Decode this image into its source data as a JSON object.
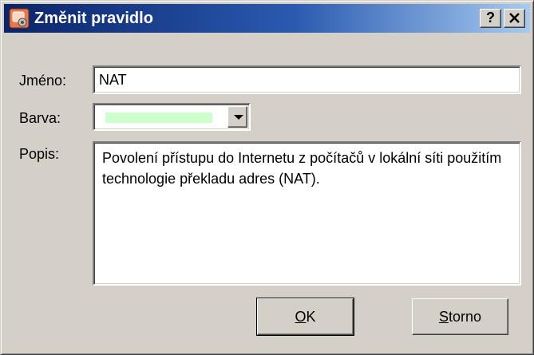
{
  "window": {
    "title": "Změnit pravidlo",
    "help_label": "?",
    "close_label": "✕",
    "icon": "rule-edit-icon"
  },
  "form": {
    "name_label": "Jméno:",
    "name_value": "NAT",
    "color_label": "Barva:",
    "color_value": "#ccffcc",
    "description_label": "Popis:",
    "description_value": "Povolení přístupu do Internetu z počítačů v lokální síti použitím technologie překladu adres (NAT)."
  },
  "buttons": {
    "ok_mnemonic": "O",
    "ok_rest": "K",
    "cancel_mnemonic": "S",
    "cancel_rest": "torno"
  }
}
